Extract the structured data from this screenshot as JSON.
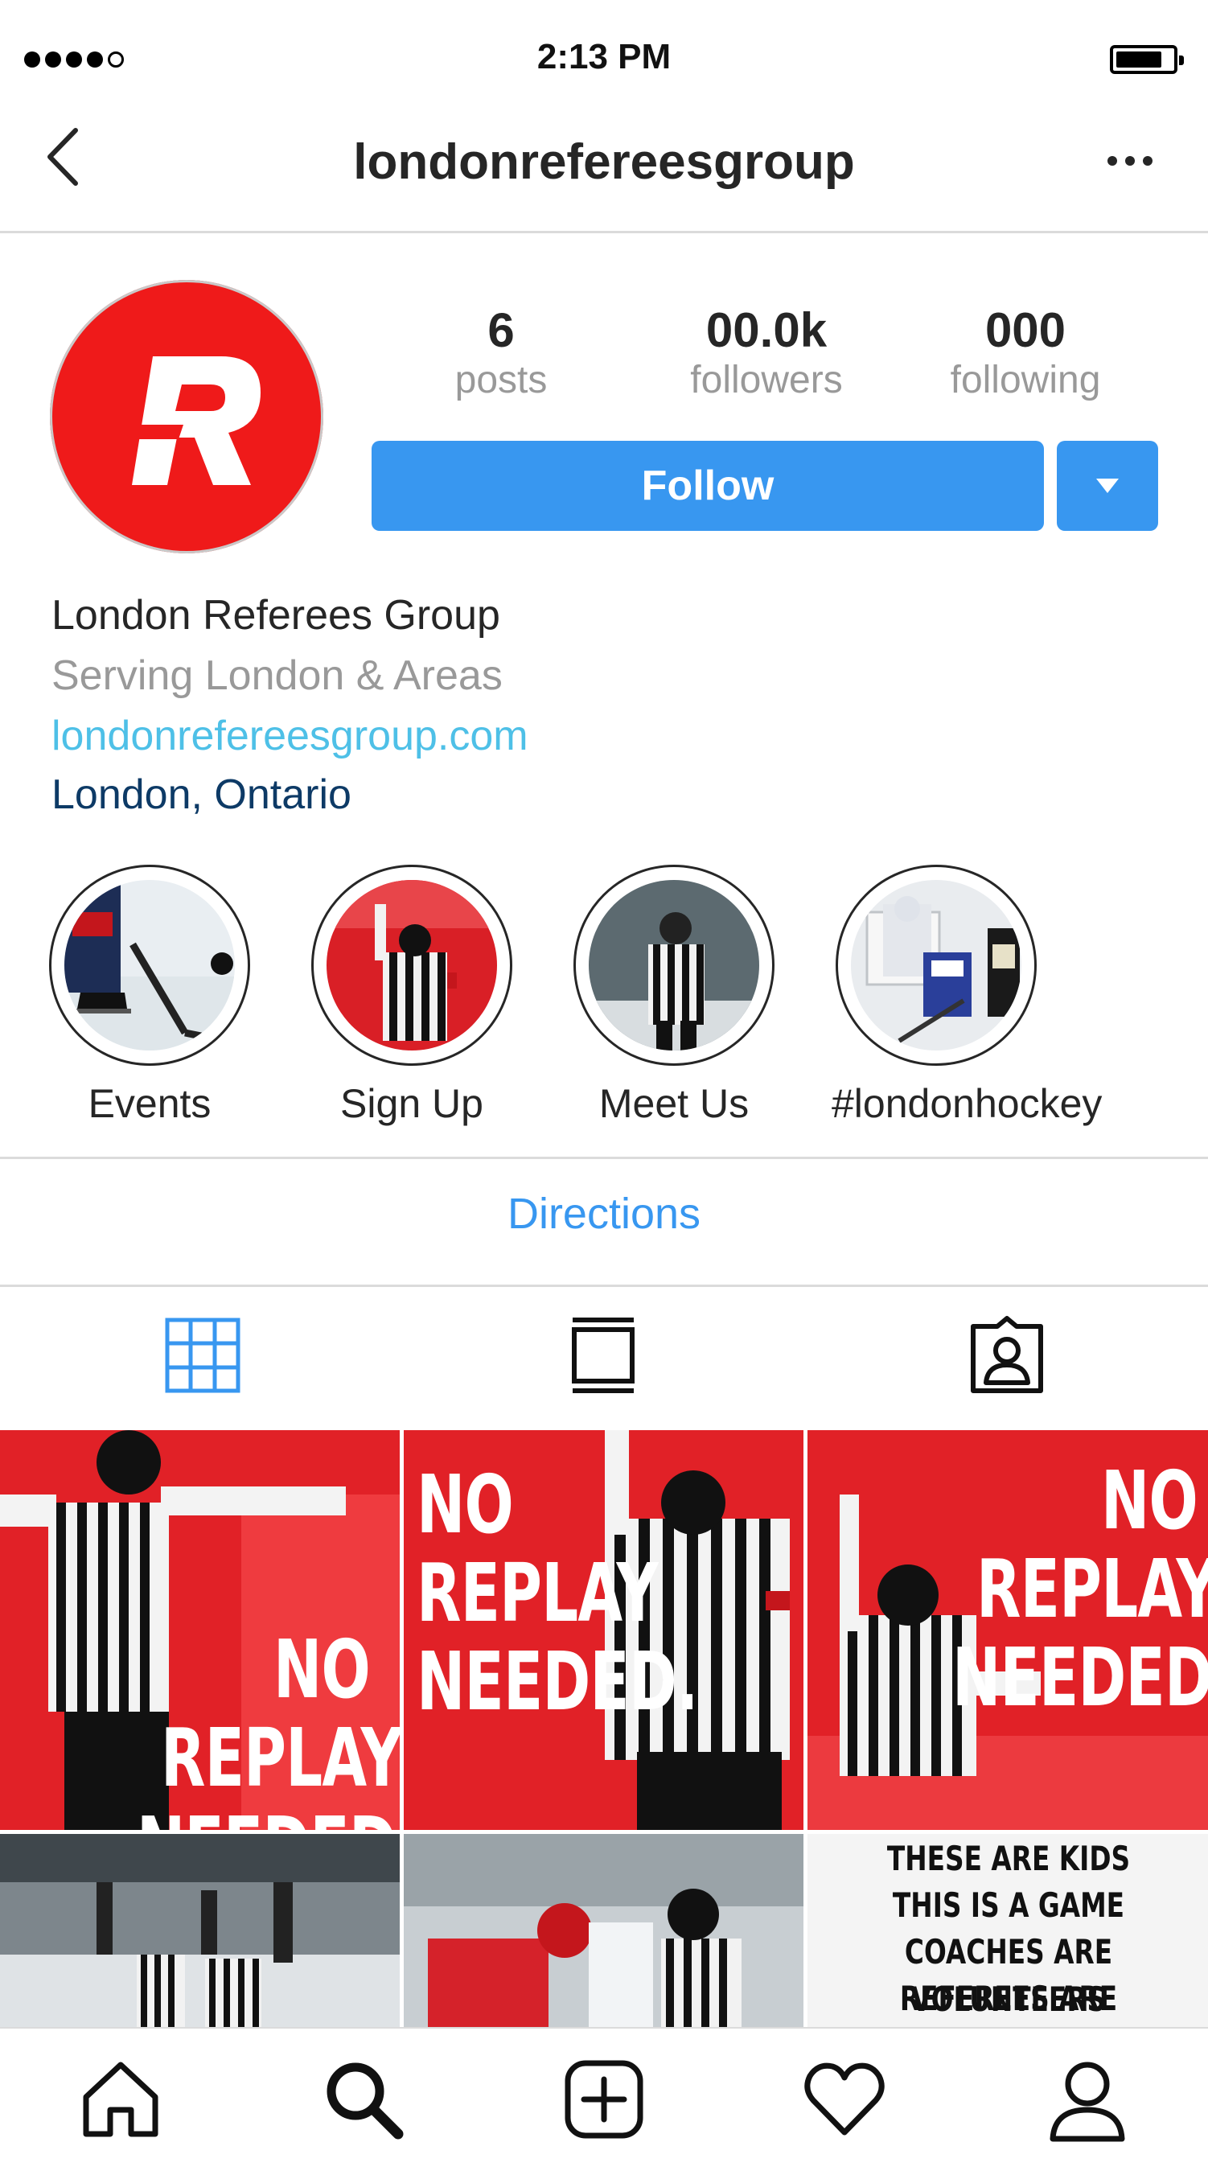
{
  "status_bar": {
    "time": "2:13 PM"
  },
  "nav": {
    "title": "londonrefereesgroup"
  },
  "profile": {
    "avatar_letter": "R",
    "stats": [
      {
        "value": "6",
        "label": "posts"
      },
      {
        "value": "00.0k",
        "label": "followers"
      },
      {
        "value": "000",
        "label": "following"
      }
    ],
    "follow_label": "Follow",
    "name": "London Referees Group",
    "tagline": "Serving London & Areas",
    "website": "londonrefereesgroup.com",
    "location": "London, Ontario"
  },
  "highlights": [
    {
      "label": "Events"
    },
    {
      "label": "Sign Up"
    },
    {
      "label": "Meet Us"
    },
    {
      "label": "#londonhockey"
    }
  ],
  "directions_label": "Directions",
  "tabs": [
    "grid-view",
    "feed-view",
    "tagged"
  ],
  "posts": [
    {
      "lines": [
        "NO",
        "REPLAY",
        "NEEDED."
      ]
    },
    {
      "lines": [
        "NO",
        "REPLAY",
        "NEEDED."
      ]
    },
    {
      "lines": [
        "NO",
        "REPLAY",
        "NEEDED."
      ]
    },
    {
      "lines": []
    },
    {
      "lines": []
    },
    {
      "lines": [
        "THESE ARE KIDS",
        "THIS IS A GAME",
        "COACHES ARE VOLUNTEERS",
        "REFEREES ARE HUMAN"
      ]
    }
  ],
  "colors": {
    "accent": "#3897f0",
    "brand_red": "#ef1a1a",
    "link": "#4ec0e7",
    "location": "#0d3a66"
  },
  "bottom_nav": [
    "home-icon",
    "search-icon",
    "add-post-icon",
    "heart-icon",
    "profile-icon"
  ]
}
